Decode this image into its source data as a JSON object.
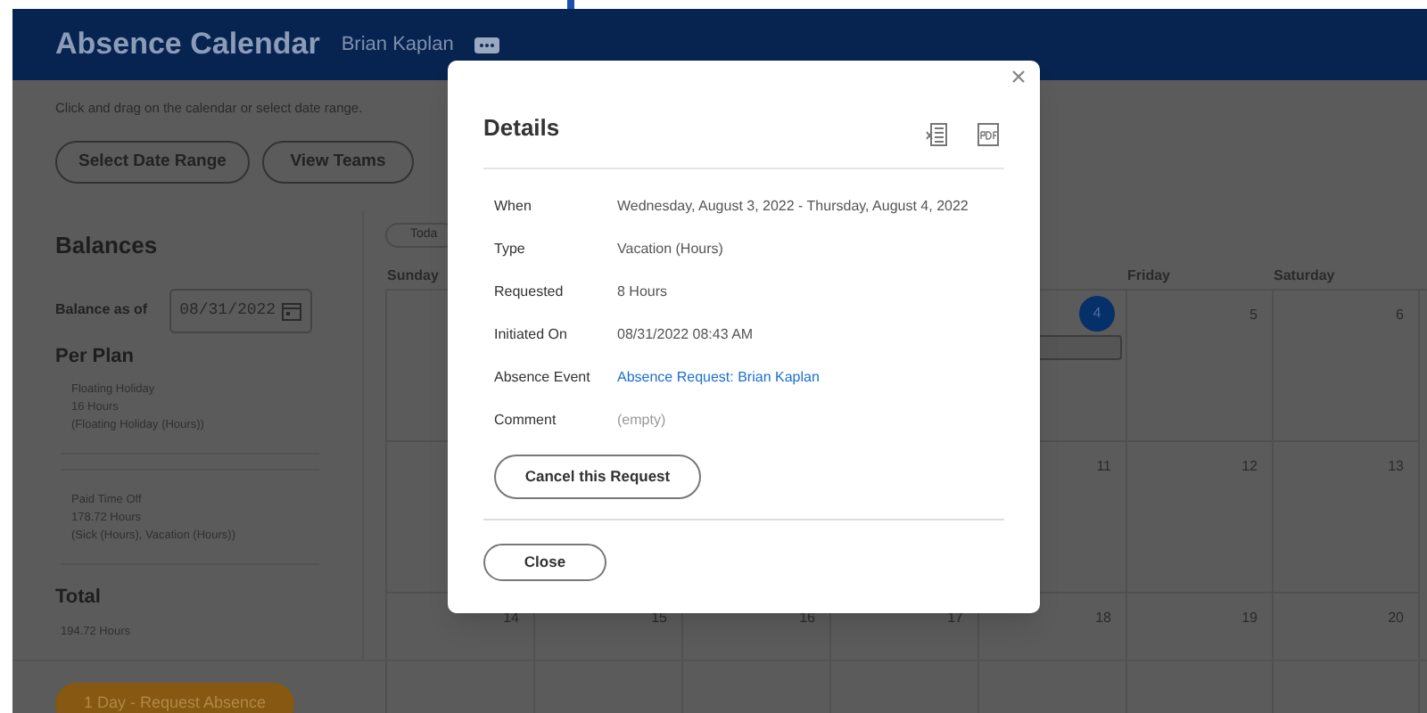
{
  "header": {
    "title": "Absence Calendar",
    "user": "Brian Kaplan"
  },
  "instruction": "Click and drag on the calendar or select date range.",
  "buttons": [
    "Select Date Range",
    "View Teams"
  ],
  "balances": {
    "title": "Balances",
    "as_of_label": "Balance as of",
    "as_of_value": "08/31/2022",
    "per_plan_title": "Per Plan",
    "plans": [
      [
        "Floating Holiday",
        "16 Hours",
        "(Floating Holiday (Hours))"
      ],
      [
        "Paid Time Off",
        "178.72 Hours",
        "(Sick (Hours), Vacation (Hours))"
      ]
    ],
    "total_title": "Total",
    "total_value": "194.72 Hours"
  },
  "request_button": "1 Day - Request Absence",
  "calendar": {
    "today_button": "Toda",
    "weekdays_left": [
      "Sunday"
    ],
    "weekdays_right": [
      "Friday",
      "Saturday"
    ],
    "weeks": [
      [
        {
          "date": "4",
          "selected": true,
          "event": true
        },
        {
          "date": "5",
          "selected": false,
          "event": false
        },
        {
          "date": "6",
          "selected": false,
          "event": false
        }
      ],
      [
        {
          "date": "11",
          "selected": false,
          "event": false
        },
        {
          "date": "12",
          "selected": false,
          "event": false
        },
        {
          "date": "13",
          "selected": false,
          "event": false
        }
      ],
      [
        {
          "date": "14",
          "selected": false,
          "event": false
        },
        {
          "date": "15",
          "selected": false,
          "event": false
        },
        {
          "date": "16",
          "selected": false,
          "event": false
        },
        {
          "date": "17",
          "selected": false,
          "event": false
        },
        {
          "date": "18",
          "selected": false,
          "event": false
        },
        {
          "date": "19",
          "selected": false,
          "event": false
        },
        {
          "date": "20",
          "selected": false,
          "event": false
        }
      ]
    ]
  },
  "dialog": {
    "title": "Details",
    "fields": [
      {
        "label": "When",
        "value": "Wednesday, August 3, 2022 - Thursday, August 4, 2022",
        "kind": "text"
      },
      {
        "label": "Type",
        "value": "Vacation (Hours)",
        "kind": "text"
      },
      {
        "label": "Requested",
        "value": "8 Hours",
        "kind": "text"
      },
      {
        "label": "Initiated On",
        "value": "08/31/2022 08:43 AM",
        "kind": "text"
      },
      {
        "label": "Absence Event",
        "value": "Absence Request: Brian Kaplan",
        "kind": "link"
      },
      {
        "label": "Comment",
        "value": "(empty)",
        "kind": "empty"
      }
    ],
    "cancel_button": "Cancel this Request",
    "close_button": "Close"
  }
}
